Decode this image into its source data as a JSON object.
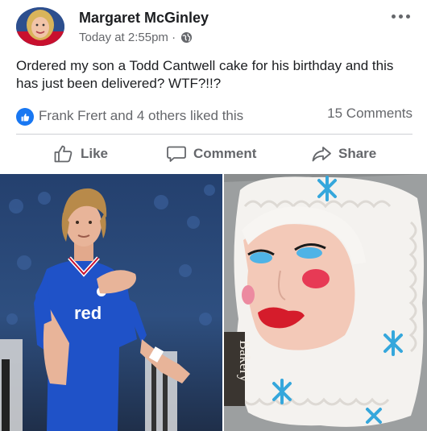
{
  "post": {
    "author": "Margaret McGinley",
    "timestamp": "Today at 2:55pm ·",
    "text": "Ordered my son a Todd Cantwell cake for his birthday and this has just been delivered? WTF?!!?",
    "likes_text": "Frank Frert and 4 others liked this",
    "comments_count": "15 Comments"
  },
  "actions": {
    "like": "Like",
    "comment": "Comment",
    "share": "Share"
  },
  "icons": {
    "privacy": "globe-icon",
    "menu": "more-options-icon",
    "reaction": "thumbs-up-icon"
  },
  "photos": {
    "left": {
      "shirt_text": "red",
      "crest_text": ""
    },
    "right": {
      "box_text": "Bakery"
    }
  },
  "colors": {
    "brand_blue": "#1877f2",
    "secondary_text": "#65676b",
    "divider": "#ced0d4"
  }
}
